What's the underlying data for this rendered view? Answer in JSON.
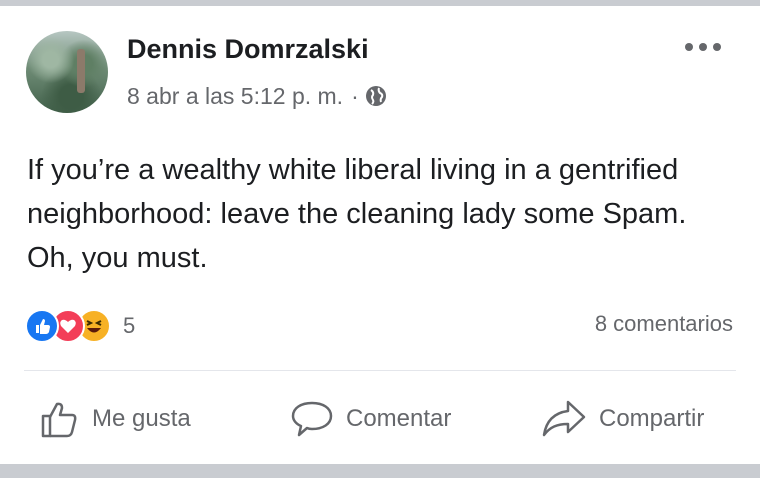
{
  "post": {
    "author": "Dennis Domrzalski",
    "timestamp": "8 abr a las 5:12 p. m.",
    "separator": "·",
    "audience_icon": "globe-icon",
    "text": "If you’re a wealthy white liberal living in a gentrified neighborhood: leave the cleaning lady some Spam. Oh, you must."
  },
  "reactions": {
    "types": [
      "like",
      "love",
      "haha"
    ],
    "count": "5",
    "comments": "8 comentarios"
  },
  "actions": {
    "like_label": "Me gusta",
    "comment_label": "Comentar",
    "share_label": "Compartir"
  },
  "colors": {
    "text": "#1c1e21",
    "secondary": "#65676b",
    "like_blue": "#1877f2",
    "love_red": "#f33e58",
    "haha_yellow": "#f7b125",
    "frame_gray": "#c9ccd1"
  }
}
